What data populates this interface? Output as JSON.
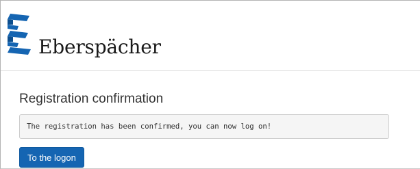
{
  "brand": {
    "name": "Eberspächer",
    "logo_icon": "eberspaecher-logo-icon",
    "logo_color": "#1565b2"
  },
  "main": {
    "title": "Registration confirmation",
    "message": "The registration has been confirmed, you can now log on!",
    "logon_button_label": "To the logon"
  },
  "colors": {
    "button": "#1565b2",
    "alert_background": "#f5f5f5"
  }
}
